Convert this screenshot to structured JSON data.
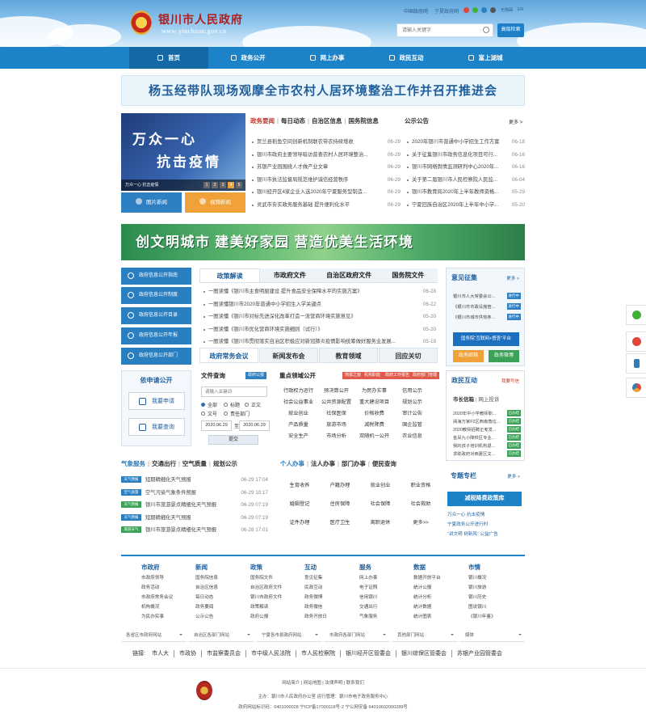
{
  "header": {
    "site_title": "银川市人民政府",
    "site_url": "www.yinchuan.gov.cn",
    "top_links": [
      "中国政府网",
      "宁夏政府网"
    ],
    "accessibility": "无障碍",
    "english": "EN",
    "search_placeholder": "请输入关键字",
    "search_button": "高级检索"
  },
  "nav": {
    "items": [
      "首页",
      "政务公开",
      "网上办事",
      "政民互动",
      "富上湖城"
    ],
    "active_index": 0
  },
  "headline": "杨玉经带队现场观摩全市农村人居环境整治工作并召开推进会",
  "slide": {
    "line1": "万众一心",
    "line2": "抗击疫情",
    "caption": "万众一心 抗击疫情",
    "pages": [
      "1",
      "2",
      "3",
      "4",
      "5"
    ],
    "active_page": 3
  },
  "media_buttons": {
    "photo": "图片新闻",
    "video": "视频新闻"
  },
  "news": {
    "tabs": [
      "政务要闻",
      "每日动态",
      "自治区信息",
      "国务院信息"
    ],
    "active_tab": 0,
    "items": [
      {
        "title": "贺兰县稻鱼空间创新机制联农带农持续增收",
        "date": "06-29"
      },
      {
        "title": "银川市政府主要领导暗访普查农村人居环境整治...",
        "date": "06-29"
      },
      {
        "title": "苏银产业园围绕人才做产业文章",
        "date": "06-29"
      },
      {
        "title": "银川市执法监督局规范维护诚信经营秩序",
        "date": "06-29"
      },
      {
        "title": "银川经开区4家企业入选2020年宁夏服务型制造...",
        "date": "06-29"
      },
      {
        "title": "灵武市夯实政务服务基础 提升便利化水平",
        "date": "06-29"
      }
    ]
  },
  "notices": {
    "title": "公示公告",
    "more": "更多 >",
    "items": [
      {
        "title": "2020年银川市普通中小学招生工作方案",
        "date": "06-18"
      },
      {
        "title": "关于征集银川市政务信息化项目可行...",
        "date": "06-16"
      },
      {
        "title": "银川市网络舆情监测研判中心2020年...",
        "date": "06-16"
      },
      {
        "title": "关于第二届银川市人民检察院人民监...",
        "date": "06-04"
      },
      {
        "title": "银川市教育局2020年上半年教师资格...",
        "date": "05-29"
      },
      {
        "title": "宁夏回族自治区2020年上半年中小学...",
        "date": "05-20"
      }
    ]
  },
  "wide_banner": "创文明城市 建美好家园 营造优美生活环境",
  "side_buttons": [
    "政府信息公开指南",
    "政府信息公开制度",
    "政府信息公开目录",
    "政府信息公开年报",
    "政府信息公开部门"
  ],
  "apply": {
    "title": "依申请公开",
    "apply_btn": "我要申请",
    "query_btn": "我要查询"
  },
  "policy": {
    "tabs": [
      "政策解读",
      "市政府文件",
      "自治区政府文件",
      "国务院文件"
    ],
    "active_tab": 0,
    "items": [
      {
        "title": "一图读懂《银川市主食明厨建设 提升食品安全保障水平的实施方案》",
        "date": "06-28"
      },
      {
        "title": "一图读懂银川市2020年普通中小学招生入学关键点",
        "date": "06-22"
      },
      {
        "title": "一图读懂《银川市对标先进深化改革打造一流营商环境实施意见》",
        "date": "05-20"
      },
      {
        "title": "一图读懂《银川市优化营商环境实施细则（试行）》",
        "date": "05-20"
      },
      {
        "title": "一图读懂《银川市贯彻落实自治区积极应对新冠肺炎疫情影响统筹做好服务业发展...",
        "date": "05-18"
      }
    ]
  },
  "bottom_tabs": {
    "items": [
      "政府常务会议",
      "新闻发布会",
      "教育领域",
      "回应关切"
    ],
    "active_tab": 0
  },
  "file_search": {
    "title": "文件查询",
    "tag": "政府公报",
    "keyword_placeholder": "请输入关键词",
    "radios": [
      "全部",
      "标题",
      "正文",
      "文号",
      "责任部门"
    ],
    "date_from": "2020.06.29",
    "date_to": "2020.06.29",
    "date_sep": "至",
    "submit": "提交"
  },
  "key_areas": {
    "title": "重点领域公开",
    "tags": [
      "简报之窗",
      "机构职能",
      "政府工作报告",
      "政府部门管理"
    ],
    "items": [
      "行政权力运行",
      "预决算公开",
      "为民办实事",
      "信用公示",
      "社会公益事业",
      "公共资源配置",
      "重大建设项目",
      "规划公示",
      "就业创业",
      "社保医保",
      "价格收费",
      "审计公告",
      "产品质量",
      "旅游市场",
      "减税降费",
      "国企监管",
      "安全生产",
      "市场分析",
      "双随机一公开",
      "农业信息"
    ]
  },
  "opinions": {
    "title": "意见征集",
    "more": "更多 >",
    "items": [
      {
        "title": "银川市人大常委会公...",
        "status": "进行中"
      },
      {
        "title": "《银川市市政设施管...",
        "status": "进行中"
      },
      {
        "title": "《银川市城市供热条...",
        "status": "进行中"
      }
    ],
    "platform_btn": "国务院“互联网+督查”平台",
    "mailbox": "政务邮箱",
    "forum": "政务微博"
  },
  "interaction": {
    "title": "政民互动",
    "write_link": "我要写信",
    "subtitle": "市长信箱",
    "subtitle2": "网上投诉",
    "items": [
      {
        "title": "2020年中小学教师职...",
        "status": "已办结"
      },
      {
        "title": "阅海万家F2区西南角垃...",
        "status": "已办结"
      },
      {
        "title": "2020教师招聘正考发...",
        "status": "已办结"
      },
      {
        "title": "金凤九小降校区专业...",
        "status": "已办结"
      },
      {
        "title": "我的孩子培训机构退...",
        "status": "已办结"
      },
      {
        "title": "求助政府对西夏区文...",
        "status": "已办结"
      }
    ]
  },
  "special": {
    "title": "专题专栏",
    "more": "更多 >",
    "btn": "减税降费政策库",
    "links": [
      "万众一心 抗击疫情",
      "宁夏政务公开进行时",
      "“讲文明 树新风” 公益广告"
    ]
  },
  "weather": {
    "tabs": [
      "气象服务",
      "交通出行",
      "空气质量",
      "规划公示"
    ],
    "active_tab": 0,
    "items": [
      {
        "label": "天气预报",
        "title": "短期精细化天气预报",
        "date": "06-29 17:04"
      },
      {
        "label": "空气质量",
        "title": "空气污染气象条件预报",
        "date": "06-29 10:17"
      },
      {
        "label": "天气预报",
        "title": "银川市旅游景点精细化天气预报",
        "date": "06-29 07:19"
      },
      {
        "label": "天气预报",
        "title": "短期精细化天气预报",
        "date": "06-29 07:19"
      },
      {
        "label": "旅游天气",
        "title": "银川市旅游景点精细化天气预报",
        "date": "06-28 17:01"
      }
    ]
  },
  "services": {
    "tabs": [
      "个人办事",
      "法人办事",
      "部门办事",
      "便民查询"
    ],
    "active_tab": 0,
    "items": [
      "生育收养",
      "户籍办理",
      "就业创业",
      "职业资格",
      "婚姻登记",
      "住房保障",
      "社会保障",
      "社会救助",
      "证件办理",
      "医疗卫生",
      "离职退休",
      "更多>>"
    ]
  },
  "footer_nav": [
    {
      "head": "市政府",
      "links": [
        "市政府领导",
        "政务活动",
        "市政府常务会议",
        "机构概况",
        "为民办实事"
      ]
    },
    {
      "head": "新闻",
      "links": [
        "国务院信息",
        "自治区信息",
        "每日动态",
        "政务要闻",
        "公示公告"
      ]
    },
    {
      "head": "政策",
      "links": [
        "国务院文件",
        "自治区政府文件",
        "银川市政府文件",
        "政策解读",
        "政府公报"
      ]
    },
    {
      "head": "互动",
      "links": [
        "意见征集",
        "民政互动",
        "政务微博",
        "政务微信",
        "政务开放日"
      ]
    },
    {
      "head": "服务",
      "links": [
        "网上办事",
        "电子证照",
        "信用银川",
        "交通出行",
        "气象服务"
      ]
    },
    {
      "head": "数据",
      "links": [
        "数据开放平台",
        "统计公报",
        "统计分析",
        "统计数据",
        "统计图表"
      ]
    },
    {
      "head": "市情",
      "links": [
        "银川概况",
        "银川旅游",
        "银川历史",
        "图说银川",
        "《银川年鉴》"
      ]
    }
  ],
  "selects": [
    "各省区市政府网站",
    "自治区各部门网站",
    "宁夏各市县政府网站",
    "市政府各部门网站",
    "其他部门网站",
    "媒体"
  ],
  "links_label": "链接:",
  "links": [
    "市人大",
    "市政协",
    "市监察委员会",
    "市中级人民法院",
    "市人民检察院",
    "银川经开区管委会",
    "银川综保区管委会",
    "苏银产业园管委会"
  ],
  "footer": {
    "line1": "网站简介 | 网站地图 | 法律声明 | 联系我们",
    "line2": "主办：银川市人民政府办公室   运行管理：银川市电子政务服务中心",
    "line3": "政府网站标识码：6401000028   宁ICP备17000118号-2   宁公网安备 64010602000289号"
  },
  "colors": {
    "primary": "#1d83c9",
    "accent_red": "#c0392b",
    "green": "#3aa157",
    "orange": "#f0a13a"
  }
}
